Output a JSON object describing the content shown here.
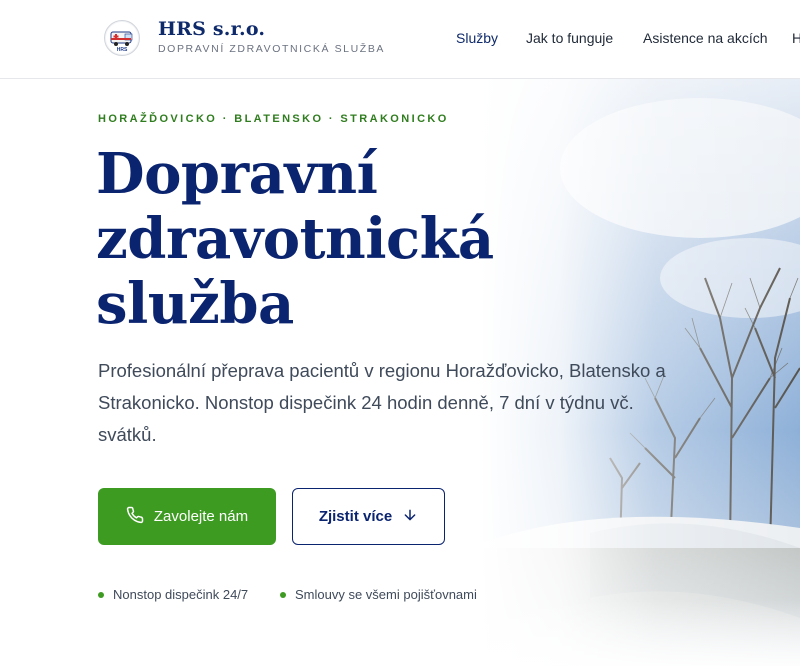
{
  "brand": {
    "name": "HRS s.r.o.",
    "subtitle": "DOPRAVNÍ ZDRAVOTNICKÁ SLUŽBA",
    "logo_icon": "ambulance-logo-icon"
  },
  "nav": {
    "items": [
      {
        "label": "Služby",
        "active": true
      },
      {
        "label": "Jak to funguje",
        "active": false
      },
      {
        "label": "Asistence na akcích",
        "active": false
      },
      {
        "label": "H",
        "active": false
      }
    ]
  },
  "hero": {
    "regions": "HORAŽĎOVICKO · BLATENSKO · STRAKONICKO",
    "title_lines": [
      "Dopravní",
      "zdravotnická",
      "služba"
    ],
    "description": "Profesionální přeprava pacientů v regionu Horažďovicko, Blatensko a Strakonicko. Nonstop dispečink 24 hodin denně, 7 dní v týdnu vč. svátků.",
    "primary_button": {
      "label": "Zavolejte nám",
      "icon": "phone-icon"
    },
    "secondary_button": {
      "label": "Zjistit více",
      "icon": "arrow-down-icon"
    },
    "features": [
      "Nonstop dispečink 24/7",
      "Smlouvy se všemi pojišťovnami"
    ]
  },
  "colors": {
    "brand_navy": "#0b2470",
    "accent_green": "#3e9b22",
    "region_green": "#2f7d1e"
  }
}
